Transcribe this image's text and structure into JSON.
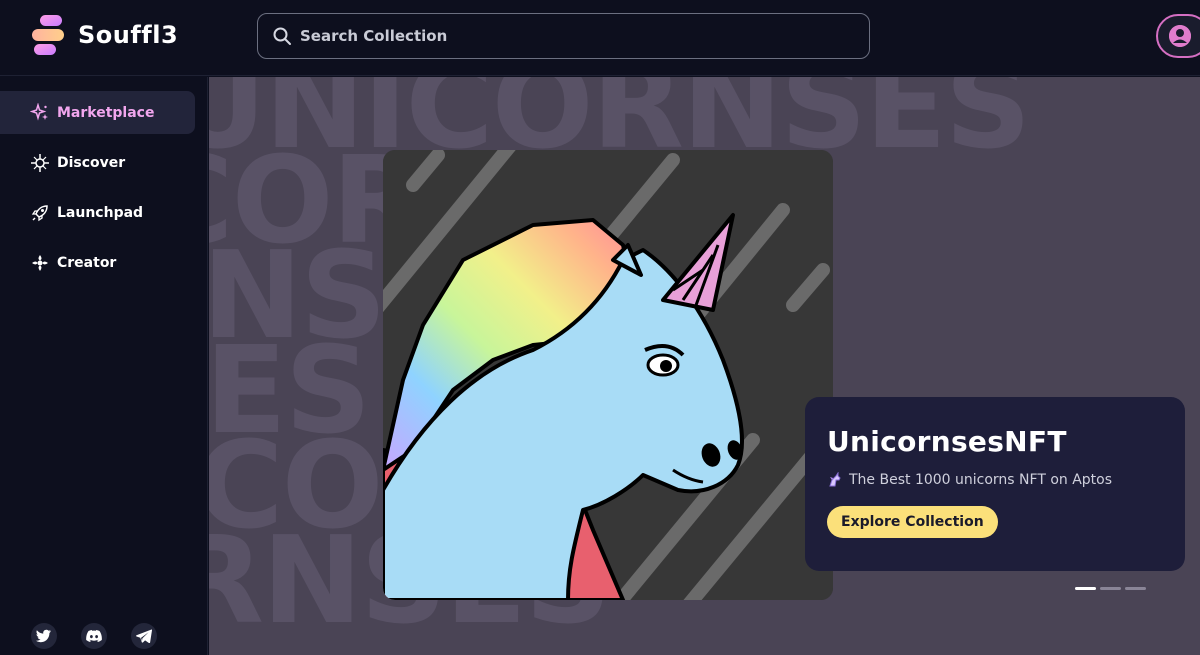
{
  "app": {
    "name": "Souffl3"
  },
  "search": {
    "placeholder": "Search Collection"
  },
  "sidebar": {
    "items": [
      {
        "label": "Marketplace",
        "icon": "sparkles-icon",
        "active": true
      },
      {
        "label": "Discover",
        "icon": "compass-icon",
        "active": false
      },
      {
        "label": "Launchpad",
        "icon": "rocket-icon",
        "active": false
      },
      {
        "label": "Creator",
        "icon": "creator-icon",
        "active": false
      }
    ],
    "socials": [
      "twitter-icon",
      "discord-icon",
      "telegram-icon"
    ]
  },
  "banner": {
    "background_text": "UNICORNSES",
    "collection_name": "UnicornsesNFT",
    "description": "The Best 1000 unicorns NFT on Aptos",
    "cta_label": "Explore Collection",
    "carousel": {
      "count": 3,
      "active_index": 0
    }
  },
  "colors": {
    "background": "#0d0f1e",
    "accent_pink": "#f2a6ee",
    "cta_yellow": "#fbe07a",
    "card": "#1e1e3a"
  }
}
